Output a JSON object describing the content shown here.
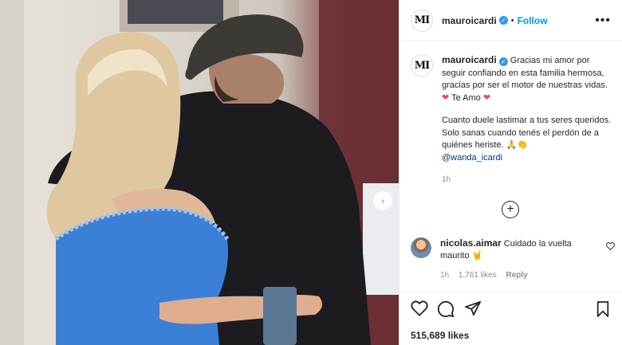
{
  "post": {
    "username": "mauroicardi",
    "follow_label": "Follow",
    "more_label": "•••",
    "avatar_monogram": "MI",
    "verified": true
  },
  "caption": {
    "username": "mauroicardi",
    "para1_text": "Gracias mi amor por seguir confiando en esta familia hermosa, gracias por ser el motor de nuestras vidas.",
    "para1_heart_a": "❤",
    "para1_te_amo": "Te Amo",
    "para1_heart_b": "❤",
    "para2_text": "Cuanto duele lastimar a tus seres queridos. Solo sanas cuando tenés el perdón de a quiénes heriste.",
    "para2_emoji": "🙏👏",
    "mention": "@wanda_icardi",
    "time": "1h"
  },
  "load_more_label": "+",
  "comments": [
    {
      "username": "nicolas.aimar",
      "text": "Cuidado la vuelta maurito",
      "emoji": "🤘",
      "time": "1h",
      "likes": "1,761 likes",
      "reply_label": "Reply"
    }
  ],
  "actions": {
    "like_icon": "heart-icon",
    "comment_icon": "comment-icon",
    "share_icon": "share-icon",
    "save_icon": "bookmark-icon"
  },
  "likes_count": "515,689 likes",
  "colors": {
    "link_blue": "#0095f6",
    "verified_blue": "#3897f0",
    "heart_red": "#ed4956",
    "text": "#262626",
    "muted": "#8e8e8e"
  },
  "photo": {
    "next_arrow": "›"
  }
}
